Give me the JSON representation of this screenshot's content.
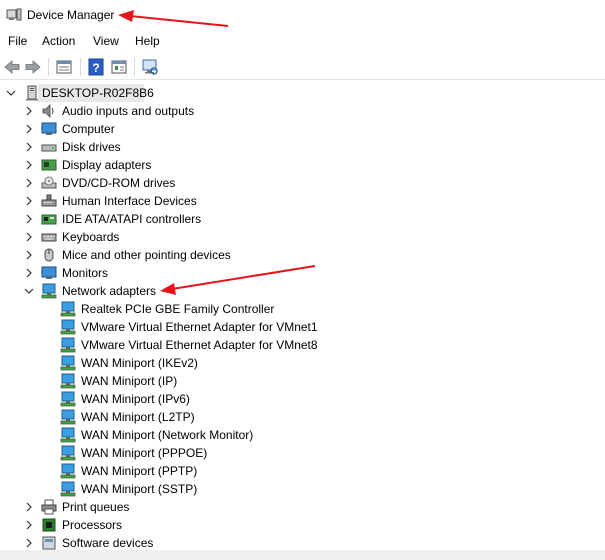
{
  "window": {
    "title": "Device Manager"
  },
  "menu": {
    "items": [
      "File",
      "Action",
      "View",
      "Help"
    ]
  },
  "toolbar": {
    "buttons": [
      "back-arrow-icon",
      "forward-arrow-icon",
      "properties-grid-icon",
      "help-icon",
      "update-driver-icon",
      "scan-hardware-icon"
    ]
  },
  "tree": {
    "root": {
      "label": "DESKTOP-R02F8B6",
      "icon": "computer-tower-icon"
    },
    "categories": [
      {
        "label": "Audio inputs and outputs",
        "icon": "speaker-icon"
      },
      {
        "label": "Computer",
        "icon": "monitor-icon"
      },
      {
        "label": "Disk drives",
        "icon": "disk-drive-icon"
      },
      {
        "label": "Display adapters",
        "icon": "display-adapter-icon"
      },
      {
        "label": "DVD/CD-ROM drives",
        "icon": "optical-drive-icon"
      },
      {
        "label": "Human Interface Devices",
        "icon": "hid-icon"
      },
      {
        "label": "IDE ATA/ATAPI controllers",
        "icon": "ide-controller-icon"
      },
      {
        "label": "Keyboards",
        "icon": "keyboard-icon"
      },
      {
        "label": "Mice and other pointing devices",
        "icon": "mouse-icon"
      },
      {
        "label": "Monitors",
        "icon": "monitor-icon"
      },
      {
        "label": "Network adapters",
        "icon": "network-adapter-icon",
        "expanded": true
      },
      {
        "label": "Print queues",
        "icon": "printer-icon"
      },
      {
        "label": "Processors",
        "icon": "processor-icon"
      },
      {
        "label": "Software devices",
        "icon": "software-device-icon"
      }
    ],
    "network_children": [
      "Realtek PCIe GBE Family Controller",
      "VMware Virtual Ethernet Adapter for VMnet1",
      "VMware Virtual Ethernet Adapter for VMnet8",
      "WAN Miniport (IKEv2)",
      "WAN Miniport (IP)",
      "WAN Miniport (IPv6)",
      "WAN Miniport (L2TP)",
      "WAN Miniport (Network Monitor)",
      "WAN Miniport (PPPOE)",
      "WAN Miniport (PPTP)",
      "WAN Miniport (SSTP)"
    ]
  },
  "colors": {
    "annotation_arrow": "#e8141c",
    "selection": "#e8e8e8"
  }
}
